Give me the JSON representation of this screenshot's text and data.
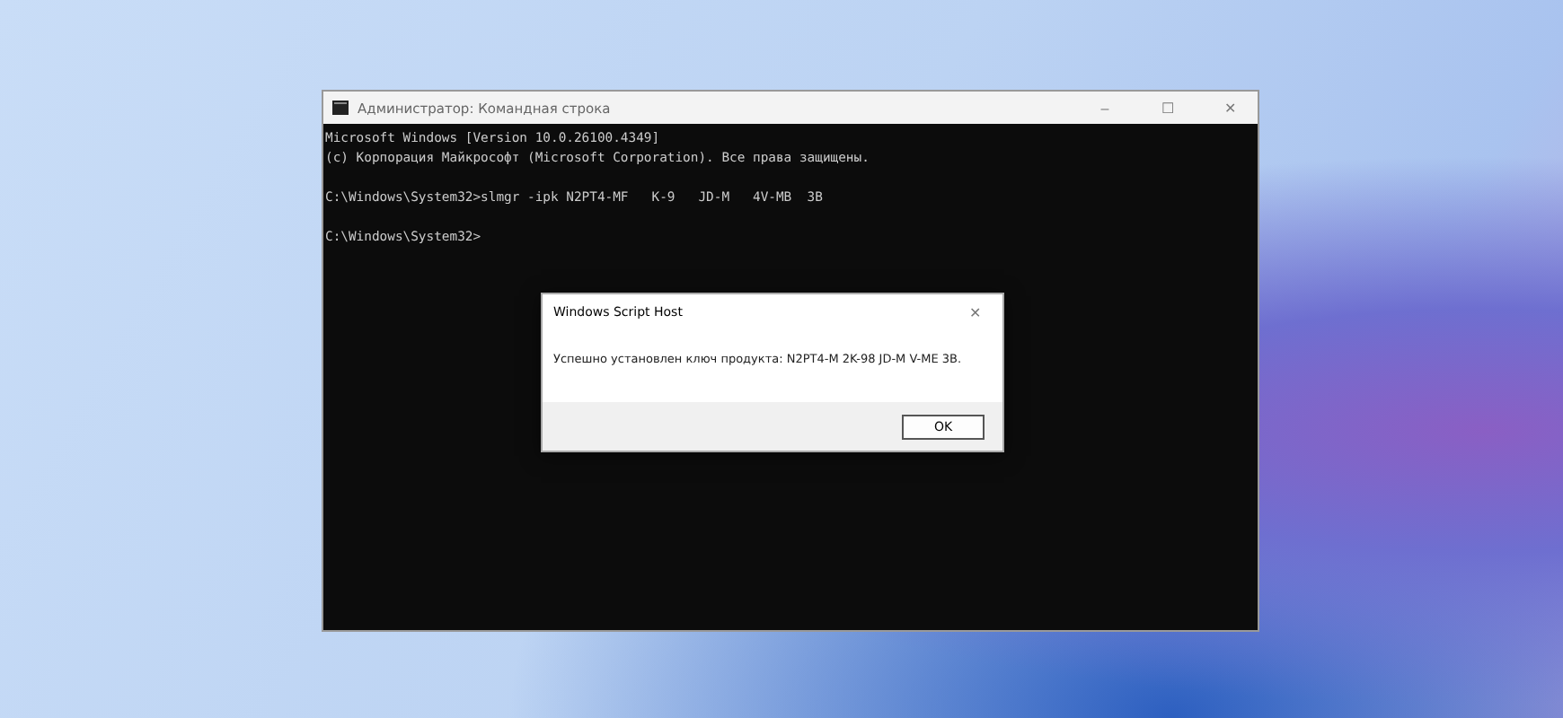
{
  "window": {
    "title": "Администратор: Командная строка",
    "controls": [
      "–",
      "☐",
      "✕"
    ]
  },
  "console": {
    "blocks": [
      [
        "Microsoft Windows [Version 10.0.26100.4349]",
        "(c) Корпорация Майкрософт (Microsoft Corporation). Все права защищены."
      ],
      [
        "C:\\Windows\\System32>slmgr -ipk N2PT4-MF   K-9   JD-M   4V-MB  3B"
      ],
      [
        "C:\\Windows\\System32>"
      ]
    ]
  },
  "dialog": {
    "title": "Windows Script Host",
    "close": "✕",
    "message": "Успешно установлен ключ продукта: N2PT4-M    2K-98    JD-M    V-ME   3B.",
    "buttons": [
      "OK"
    ]
  }
}
